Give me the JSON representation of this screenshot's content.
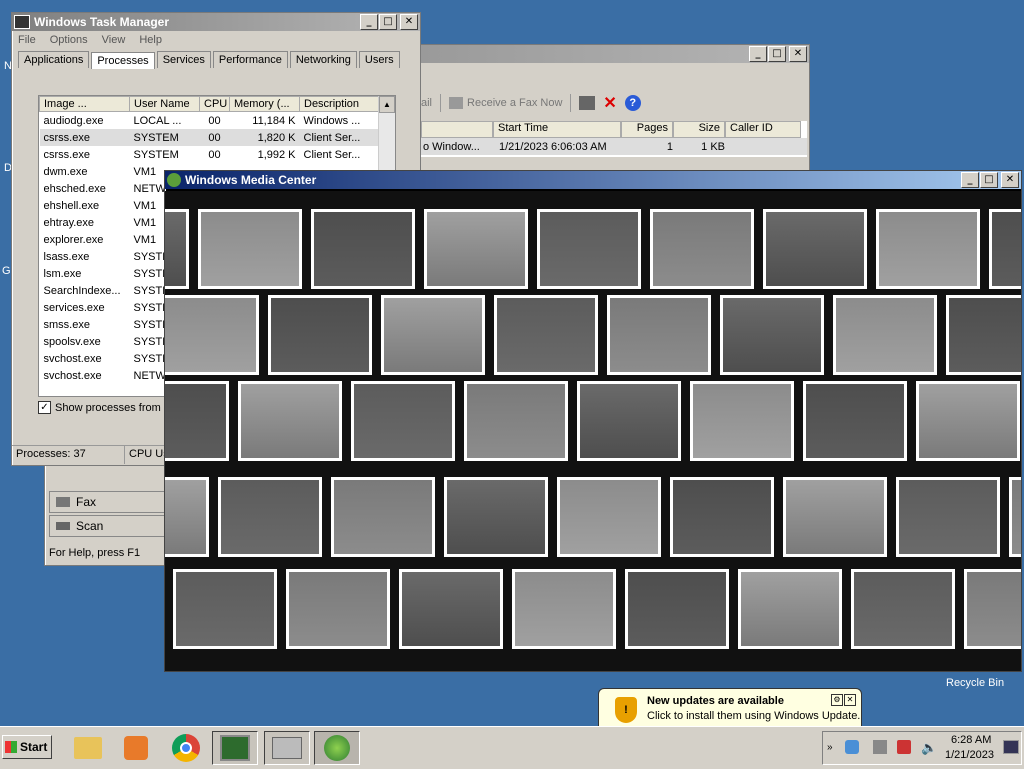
{
  "taskmgr": {
    "title": "Windows Task Manager",
    "menu": [
      "File",
      "Options",
      "View",
      "Help"
    ],
    "tabs": [
      "Applications",
      "Processes",
      "Services",
      "Performance",
      "Networking",
      "Users"
    ],
    "columns": [
      "Image ...",
      "User Name",
      "CPU",
      "Memory (...",
      "Description"
    ],
    "rows": [
      [
        "audiodg.exe",
        "LOCAL ...",
        "00",
        "11,184 K",
        "Windows ..."
      ],
      [
        "csrss.exe",
        "SYSTEM",
        "00",
        "1,820 K",
        "Client Ser..."
      ],
      [
        "csrss.exe",
        "SYSTEM",
        "00",
        "1,992 K",
        "Client Ser..."
      ],
      [
        "dwm.exe",
        "VM1",
        "",
        "",
        " "
      ],
      [
        "ehsched.exe",
        "NETW",
        "",
        "",
        ""
      ],
      [
        "ehshell.exe",
        "VM1",
        "",
        "",
        ""
      ],
      [
        "ehtray.exe",
        "VM1",
        "",
        "",
        ""
      ],
      [
        "explorer.exe",
        "VM1",
        "",
        "",
        ""
      ],
      [
        "lsass.exe",
        "SYSTE",
        "",
        "",
        ""
      ],
      [
        "lsm.exe",
        "SYSTE",
        "",
        "",
        ""
      ],
      [
        "SearchIndexe...",
        "SYSTE",
        "",
        "",
        ""
      ],
      [
        "services.exe",
        "SYSTE",
        "",
        "",
        ""
      ],
      [
        "smss.exe",
        "SYSTE",
        "",
        "",
        ""
      ],
      [
        "spoolsv.exe",
        "SYSTE",
        "",
        "",
        ""
      ],
      [
        "svchost.exe",
        "SYSTE",
        "",
        "",
        ""
      ],
      [
        "svchost.exe",
        "NETW",
        "",
        "",
        ""
      ]
    ],
    "show_all": "Show processes from a",
    "status_processes": "Processes: 37",
    "status_cpu": "CPU Usa"
  },
  "fax": {
    "toolbar_mail": "ail",
    "receive": "Receive a Fax Now",
    "columns": [
      "Start Time",
      "Pages",
      "Size",
      "Caller ID"
    ],
    "row": [
      "o Window...",
      "1/21/2023 6:06:03 AM",
      "1",
      "1 KB"
    ],
    "nav_fax": "Fax",
    "nav_scan": "Scan",
    "status": "For Help, press F1"
  },
  "wmc": {
    "title": "Windows Media Center"
  },
  "desktop": {
    "recycle_bin": "Recycle Bin",
    "left_labels": [
      "N",
      "D",
      "G"
    ]
  },
  "notification": {
    "title": "New updates are available",
    "body": "Click to install them using Windows Update."
  },
  "taskbar": {
    "start": "Start",
    "time": "6:28 AM",
    "date": "1/21/2023"
  }
}
